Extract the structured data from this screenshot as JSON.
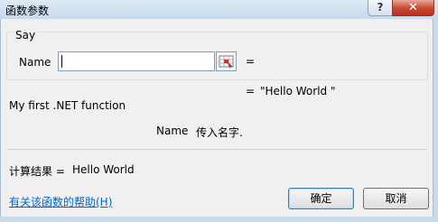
{
  "window": {
    "title": "函数参数",
    "help_glyph": "?",
    "close_glyph": "✕"
  },
  "function": {
    "name": "Say",
    "description": "My first .NET function"
  },
  "argument": {
    "label": "Name",
    "value": "",
    "equals": "=",
    "current_value_equals": "=",
    "current_value": "\"Hello World \"",
    "desc_name": "Name",
    "desc_text": "传入名字."
  },
  "result": {
    "label": "计算结果 =",
    "value": "Hello World"
  },
  "help_link": "有关该函数的帮助(H)",
  "buttons": {
    "ok": "确定",
    "cancel": "取消"
  },
  "icons": {
    "range_select": "range-select-icon"
  }
}
